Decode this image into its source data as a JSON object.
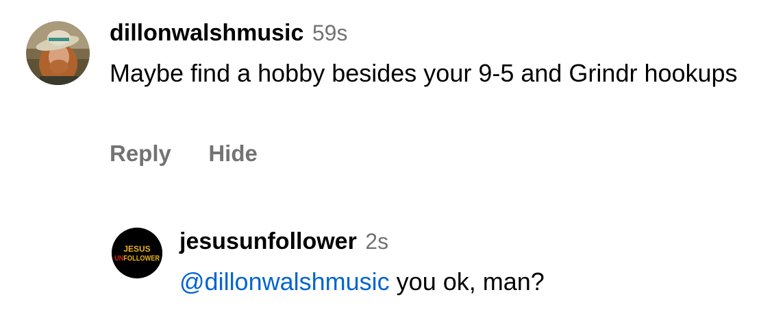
{
  "comments": [
    {
      "username": "dillonwalshmusic",
      "time": "59s",
      "text": "Maybe find a hobby besides your 9-5 and Grindr hookups",
      "actions": {
        "reply": "Reply",
        "hide": "Hide"
      }
    }
  ],
  "reply": {
    "username": "jesusunfollower",
    "time": "2s",
    "mention": "@dillonwalshmusic",
    "text": "you ok, man?",
    "avatar_logo": {
      "line1": "JESUS",
      "line2_prefix": "UN",
      "line2_rest": "FOLLOWER"
    }
  },
  "colors": {
    "text": "#000000",
    "secondary": "#737373",
    "mention": "#0064d1",
    "logo_gold": "#e8b11c",
    "logo_red": "#d8201f"
  }
}
